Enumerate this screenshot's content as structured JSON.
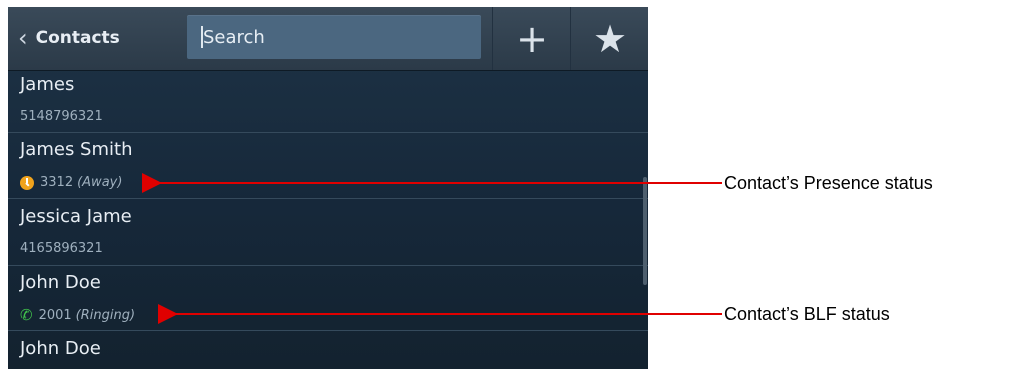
{
  "header": {
    "back_label": "Contacts",
    "search_value": "Search",
    "add_icon": "plus",
    "favorites_icon": "star"
  },
  "contacts": [
    {
      "name": "James",
      "detail": "5148796321"
    },
    {
      "name": "James Smith",
      "number": "3312",
      "status": "(Away)",
      "icon": "presence-away-clock"
    },
    {
      "name": "Jessica Jame",
      "detail": "4165896321"
    },
    {
      "name": "John Doe",
      "number": "2001",
      "status": "(Ringing)",
      "icon": "blf-ringing-phone"
    },
    {
      "name": "John Doe"
    }
  ],
  "annotations": {
    "presence": "Contact’s Presence status",
    "blf": "Contact’s BLF status"
  },
  "colors": {
    "arrow": "#e00000",
    "presence_away": "#f0a31c",
    "blf_ringing": "#40c04b"
  }
}
